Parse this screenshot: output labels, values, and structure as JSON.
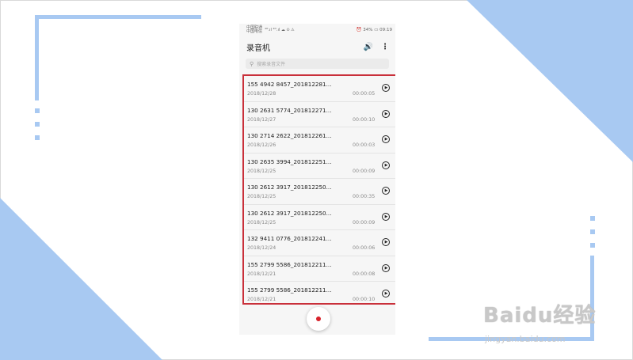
{
  "status_bar": {
    "carrier1": "中国联通",
    "carrier2": "中国电信",
    "signal": "⁴ᴳ.ıl ⁴ᴳ.ıl ☁ ⊙ ⚠",
    "right": "⏰ 34% ▭ 09:19"
  },
  "app": {
    "title": "录音机",
    "speaker_icon": "speaker-icon",
    "more_icon": "more-vertical-icon"
  },
  "search": {
    "placeholder": "搜索录音文件"
  },
  "recordings": [
    {
      "name": "155 4942 8457_201812281...",
      "date": "2018/12/28",
      "duration": "00:00:05"
    },
    {
      "name": "130 2631 5774_201812271...",
      "date": "2018/12/27",
      "duration": "00:00:10"
    },
    {
      "name": "130 2714 2622_201812261...",
      "date": "2018/12/26",
      "duration": "00:00:03"
    },
    {
      "name": "130 2635 3994_201812251...",
      "date": "2018/12/25",
      "duration": "00:00:09"
    },
    {
      "name": "130 2612 3917_201812250...",
      "date": "2018/12/25",
      "duration": "00:00:35"
    },
    {
      "name": "130 2612 3917_201812250...",
      "date": "2018/12/25",
      "duration": "00:00:09"
    },
    {
      "name": "132 9411 0776_201812241...",
      "date": "2018/12/24",
      "duration": "00:00:06"
    },
    {
      "name": "155 2799 5586_201812211...",
      "date": "2018/12/21",
      "duration": "00:00:08"
    },
    {
      "name": "155 2799 5586_201812211...",
      "date": "2018/12/21",
      "duration": "00:00:10"
    }
  ],
  "watermark": {
    "main": "Baidu经验",
    "sub": "jingyan.baidu.com"
  },
  "colors": {
    "accent_blue": "#a8c9f2",
    "highlight_red": "#c9303a",
    "record_red": "#d8222b"
  }
}
